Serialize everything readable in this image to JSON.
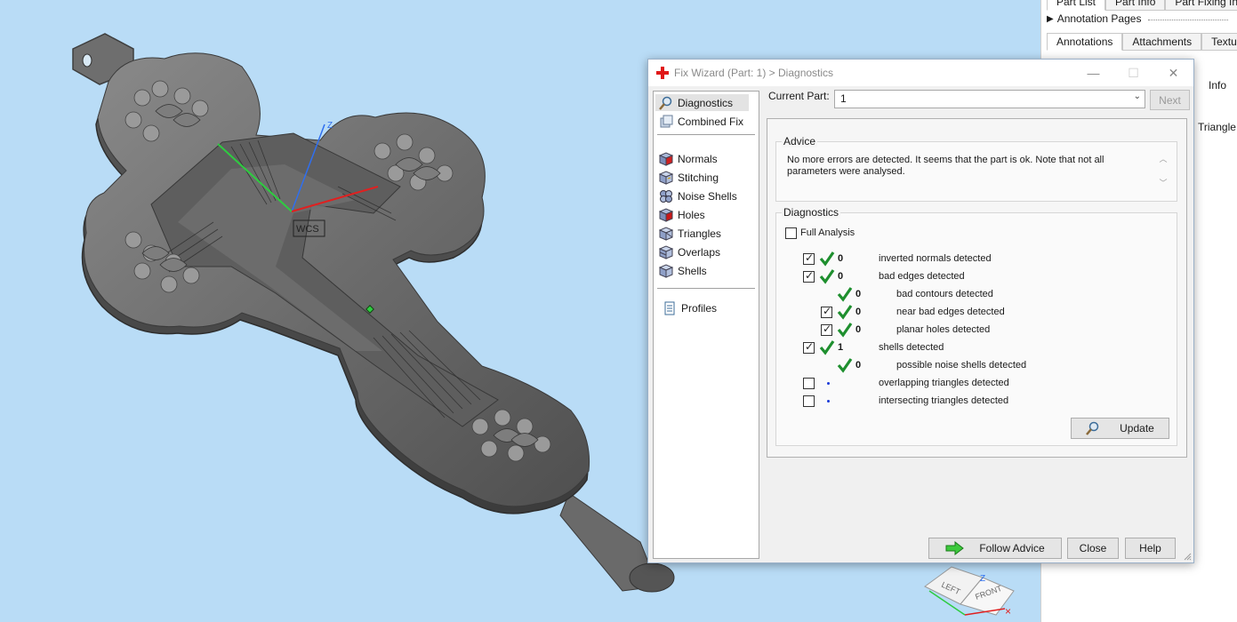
{
  "viewport": {
    "wcs_label": "WCS",
    "axis_z_label": "Z",
    "cube": {
      "left": "LEFT",
      "front": "FRONT",
      "z": "Z"
    }
  },
  "side_panel": {
    "top_tabs": [
      "Part List",
      "Part Info",
      "Part Fixing Info"
    ],
    "annotation_pages": "Annotation Pages",
    "tabs": [
      "Annotations",
      "Attachments",
      "Textures"
    ],
    "info_label": "Info",
    "triangle_label": "Triangle"
  },
  "dialog": {
    "title": "Fix Wizard (Part: 1) > Diagnostics",
    "nav": {
      "top": [
        {
          "label": "Diagnostics",
          "icon": "magnifier-icon"
        },
        {
          "label": "Combined Fix",
          "icon": "combined-fix-icon"
        }
      ],
      "tools": [
        {
          "label": "Normals",
          "icon": "normals-cube-icon"
        },
        {
          "label": "Stitching",
          "icon": "stitching-cube-icon"
        },
        {
          "label": "Noise Shells",
          "icon": "noise-shells-icon"
        },
        {
          "label": "Holes",
          "icon": "holes-cube-icon"
        },
        {
          "label": "Triangles",
          "icon": "triangles-cube-icon"
        },
        {
          "label": "Overlaps",
          "icon": "overlaps-cube-icon"
        },
        {
          "label": "Shells",
          "icon": "shells-cube-icon"
        }
      ],
      "profiles": {
        "label": "Profiles",
        "icon": "profiles-document-icon"
      }
    },
    "current_part_label": "Current Part:",
    "current_part_value": "1",
    "next_label": "Next",
    "advice": {
      "legend": "Advice",
      "text": "No more errors are detected. It seems that the part is ok. Note that not all parameters were analysed."
    },
    "diagnostics": {
      "legend": "Diagnostics",
      "full_analysis_label": "Full Analysis",
      "full_analysis_checked": false,
      "rows": [
        {
          "checkbox": true,
          "checked": true,
          "status": "ok",
          "count": "0",
          "label": "inverted normals detected",
          "indent": 0
        },
        {
          "checkbox": true,
          "checked": true,
          "status": "ok",
          "count": "0",
          "label": "bad edges detected",
          "indent": 0
        },
        {
          "checkbox": false,
          "checked": false,
          "status": "ok",
          "count": "0",
          "label": "bad contours detected",
          "indent": 1
        },
        {
          "checkbox": true,
          "checked": true,
          "status": "ok",
          "count": "0",
          "label": "near bad edges detected",
          "indent": 1
        },
        {
          "checkbox": true,
          "checked": true,
          "status": "ok",
          "count": "0",
          "label": "planar holes detected",
          "indent": 1
        },
        {
          "checkbox": true,
          "checked": true,
          "status": "ok",
          "count": "1",
          "label": "shells detected",
          "indent": 0
        },
        {
          "checkbox": false,
          "checked": false,
          "status": "ok",
          "count": "0",
          "label": "possible noise shells detected",
          "indent": 1
        },
        {
          "checkbox": true,
          "checked": false,
          "status": "unchecked",
          "count": "",
          "label": "overlapping triangles detected",
          "indent": 0
        },
        {
          "checkbox": true,
          "checked": false,
          "status": "unchecked",
          "count": "",
          "label": "intersecting triangles detected",
          "indent": 0
        }
      ],
      "update_label": "Update"
    },
    "buttons": {
      "follow_advice": "Follow Advice",
      "close": "Close",
      "help": "Help"
    },
    "colors": {
      "check_green": "#1e8f2e",
      "title_red": "#e01818",
      "dot_blue": "#1a3ad8"
    }
  }
}
